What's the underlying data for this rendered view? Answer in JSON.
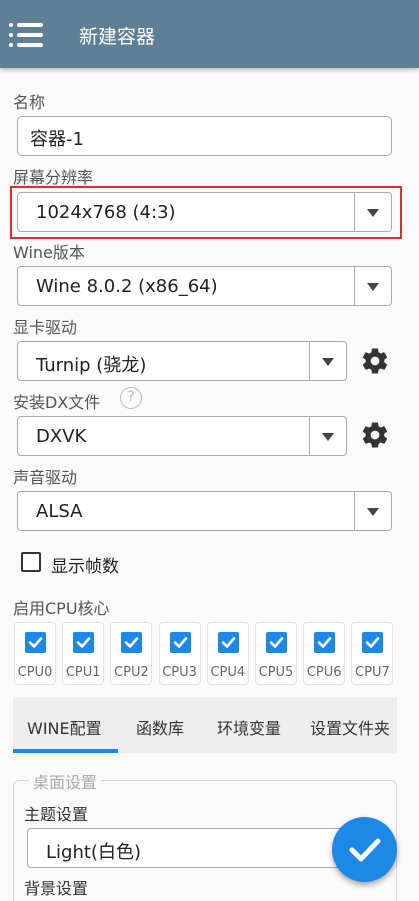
{
  "appbar": {
    "title": "新建容器",
    "icon": "menu-icon"
  },
  "name_field": {
    "label": "名称",
    "value": "容器-1"
  },
  "resolution": {
    "label": "屏幕分辨率",
    "value": "1024x768 (4:3)"
  },
  "wine_version": {
    "label": "Wine版本",
    "value": "Wine 8.0.2 (x86_64)"
  },
  "gpu_driver": {
    "label": "显卡驱动",
    "value": "Turnip (骁龙)"
  },
  "dx": {
    "label": "安装DX文件",
    "help": "?",
    "value": "DXVK"
  },
  "audio": {
    "label": "声音驱动",
    "value": "ALSA"
  },
  "show_fps": {
    "label": "显示帧数",
    "checked": false
  },
  "cpu": {
    "label": "启用CPU核心",
    "cores": [
      {
        "name": "CPU0",
        "checked": true
      },
      {
        "name": "CPU1",
        "checked": true
      },
      {
        "name": "CPU2",
        "checked": true
      },
      {
        "name": "CPU3",
        "checked": true
      },
      {
        "name": "CPU4",
        "checked": true
      },
      {
        "name": "CPU5",
        "checked": true
      },
      {
        "name": "CPU6",
        "checked": true
      },
      {
        "name": "CPU7",
        "checked": true
      }
    ]
  },
  "tabs": {
    "items": [
      "WINE配置",
      "函数库",
      "环境变量",
      "设置文件夹"
    ],
    "active": 0
  },
  "desktop": {
    "section_title": "桌面设置",
    "theme_label": "主题设置",
    "theme_value": "Light(白色)",
    "bg_label": "背景设置"
  },
  "colors": {
    "appbar": "#5f7f94",
    "accent": "#1e88e5",
    "highlight": "#d93030"
  }
}
